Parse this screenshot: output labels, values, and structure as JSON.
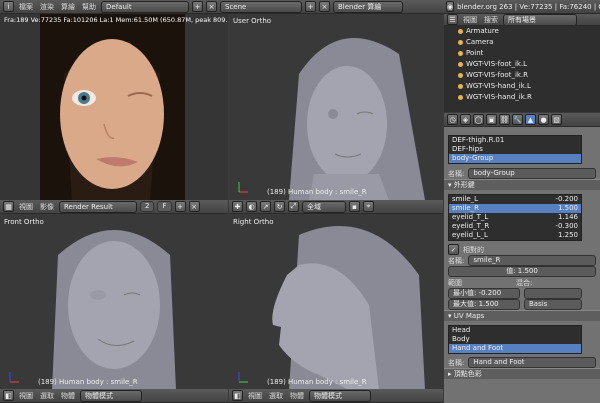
{
  "topbar": {
    "menus": [
      "檔案",
      "渲染",
      "算繪",
      "幫助"
    ],
    "layout": "Default",
    "scene": "Scene",
    "engine": "Blender 算繪",
    "stats": "blender.org 263 | Ve:77235 | Fa:76240 | Ob:0"
  },
  "image_editor": {
    "info": "Fra:189  Ve:77235 Fa:101206 La:1 Mem:61.50M (650.87M, peak 809.5",
    "menus": [
      "視圖",
      "影像"
    ],
    "image_name": "Render Result",
    "slot": "2",
    "slot_suffix": "F"
  },
  "viewports": {
    "user": {
      "label": "User Ortho",
      "status": "(189) Human body : smile_R"
    },
    "front": {
      "label": "Front Ortho",
      "status": "(189) Human body : smile_R"
    },
    "right": {
      "label": "Right Ortho",
      "status": "(189) Human body : smile_R"
    },
    "header_menus": [
      "視圖",
      "選取",
      "物體"
    ],
    "mode": "物體模式",
    "global": "全域"
  },
  "outliner": {
    "menus": [
      "視圖",
      "搜索"
    ],
    "filter": "所有場景",
    "items": [
      "Armature",
      "Camera",
      "Point",
      "WGT-VIS-foot_ik.L",
      "WGT-VIS-foot_ik.R",
      "WGT-VIS-hand_ik.L",
      "WGT-VIS-hand_ik.R"
    ]
  },
  "properties": {
    "vgroups": [
      "DEF-thigh.R.01",
      "DEF-hips",
      "body-Group"
    ],
    "vgroup_name_label": "名稱:",
    "vgroup_name": "body-Group",
    "shapekeys_header": "外形鍵",
    "shapekeys": [
      {
        "name": "smile_L",
        "value": "-0.200"
      },
      {
        "name": "smile_R",
        "value": "1.500"
      },
      {
        "name": "eyelid_T_L",
        "value": "1.146"
      },
      {
        "name": "eyelid_T_R",
        "value": "-0.300"
      },
      {
        "name": "eyelid_L_L",
        "value": "1.250"
      }
    ],
    "relative_label": "相對的",
    "sk_name_label": "名稱:",
    "sk_name": "smile_R",
    "value_field": "值: 1.500",
    "range_label": "範圍",
    "blend_label": "混合:",
    "min_label": "最小值: -0.200",
    "max_label": "最大值: 1.500",
    "basis": "Basis",
    "uv_header": "UV Maps",
    "uvmaps": [
      "Head",
      "Body",
      "Hand and Foot"
    ],
    "uv_name_label": "名稱:",
    "uv_name": "Hand and Foot",
    "vertex_color_header": "頂點色彩"
  }
}
